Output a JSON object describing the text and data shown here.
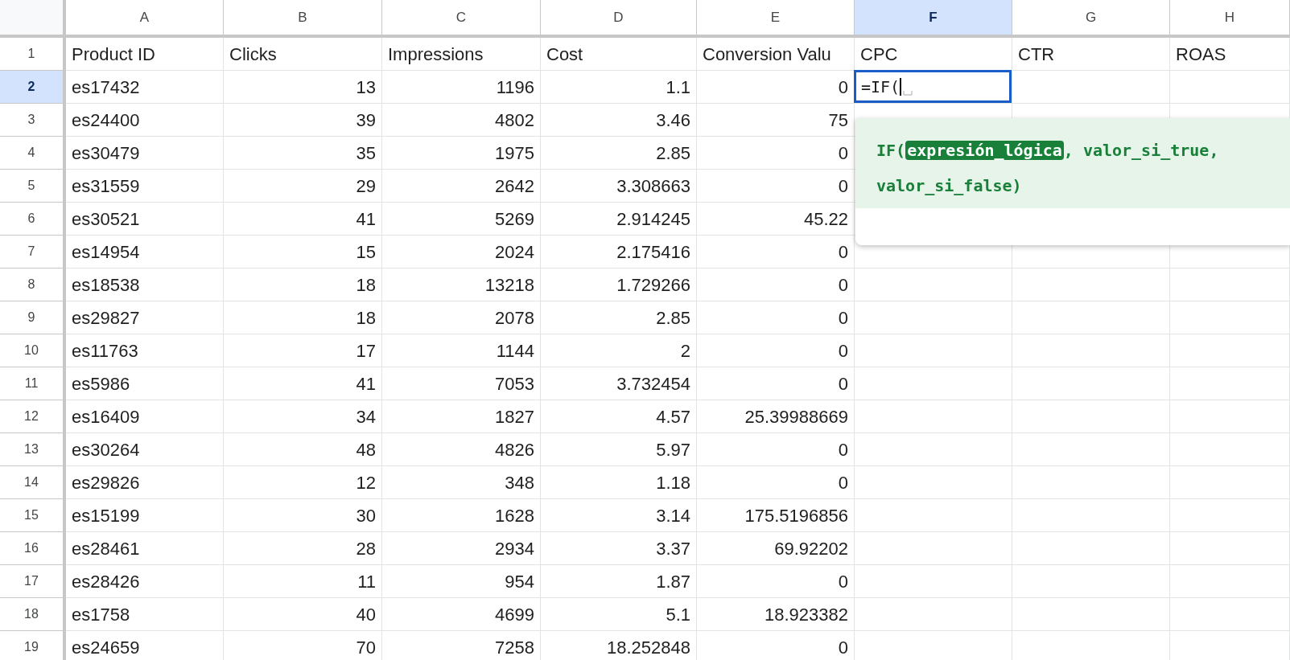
{
  "columns": [
    {
      "label": "A",
      "selected": false
    },
    {
      "label": "B",
      "selected": false
    },
    {
      "label": "C",
      "selected": false
    },
    {
      "label": "D",
      "selected": false
    },
    {
      "label": "E",
      "selected": false
    },
    {
      "label": "F",
      "selected": true
    },
    {
      "label": "G",
      "selected": false
    },
    {
      "label": "H",
      "selected": false
    }
  ],
  "header_row": {
    "number": "1",
    "selected": false,
    "cells": [
      "Product ID",
      "Clicks",
      "Impressions",
      "Cost",
      "Conversion Valu",
      "CPC",
      "CTR",
      "ROAS"
    ]
  },
  "rows": [
    {
      "number": "2",
      "selected": true,
      "cells": [
        "es17432",
        "13",
        "1196",
        "1.1",
        "0"
      ],
      "editor_value": "=IF("
    },
    {
      "number": "3",
      "selected": false,
      "cells": [
        "es24400",
        "39",
        "4802",
        "3.46",
        "75"
      ]
    },
    {
      "number": "4",
      "selected": false,
      "cells": [
        "es30479",
        "35",
        "1975",
        "2.85",
        "0"
      ]
    },
    {
      "number": "5",
      "selected": false,
      "cells": [
        "es31559",
        "29",
        "2642",
        "3.308663",
        "0"
      ]
    },
    {
      "number": "6",
      "selected": false,
      "cells": [
        "es30521",
        "41",
        "5269",
        "2.914245",
        "45.22"
      ]
    },
    {
      "number": "7",
      "selected": false,
      "cells": [
        "es14954",
        "15",
        "2024",
        "2.175416",
        "0"
      ]
    },
    {
      "number": "8",
      "selected": false,
      "cells": [
        "es18538",
        "18",
        "13218",
        "1.729266",
        "0"
      ]
    },
    {
      "number": "9",
      "selected": false,
      "cells": [
        "es29827",
        "18",
        "2078",
        "2.85",
        "0"
      ]
    },
    {
      "number": "10",
      "selected": false,
      "cells": [
        "es11763",
        "17",
        "1144",
        "2",
        "0"
      ]
    },
    {
      "number": "11",
      "selected": false,
      "cells": [
        "es5986",
        "41",
        "7053",
        "3.732454",
        "0"
      ]
    },
    {
      "number": "12",
      "selected": false,
      "cells": [
        "es16409",
        "34",
        "1827",
        "4.57",
        "25.39988669"
      ]
    },
    {
      "number": "13",
      "selected": false,
      "cells": [
        "es30264",
        "48",
        "4826",
        "5.97",
        "0"
      ]
    },
    {
      "number": "14",
      "selected": false,
      "cells": [
        "es29826",
        "12",
        "348",
        "1.18",
        "0"
      ]
    },
    {
      "number": "15",
      "selected": false,
      "cells": [
        "es15199",
        "30",
        "1628",
        "3.14",
        "175.5196856"
      ]
    },
    {
      "number": "16",
      "selected": false,
      "cells": [
        "es28461",
        "28",
        "2934",
        "3.37",
        "69.92202"
      ]
    },
    {
      "number": "17",
      "selected": false,
      "cells": [
        "es28426",
        "11",
        "954",
        "1.87",
        "0"
      ]
    },
    {
      "number": "18",
      "selected": false,
      "cells": [
        "es1758",
        "40",
        "4699",
        "5.1",
        "18.923382"
      ]
    },
    {
      "number": "19",
      "selected": false,
      "cells": [
        "es24659",
        "70",
        "7258",
        "18.252848",
        "0"
      ]
    }
  ],
  "formula_hint": {
    "function": "IF(",
    "separator": ", ",
    "closing": ")",
    "params": [
      {
        "text": "expresión_lógica",
        "selected": true
      },
      {
        "text": "valor_si_true",
        "selected": false
      },
      {
        "text": "valor_si_false",
        "selected": false
      }
    ]
  }
}
